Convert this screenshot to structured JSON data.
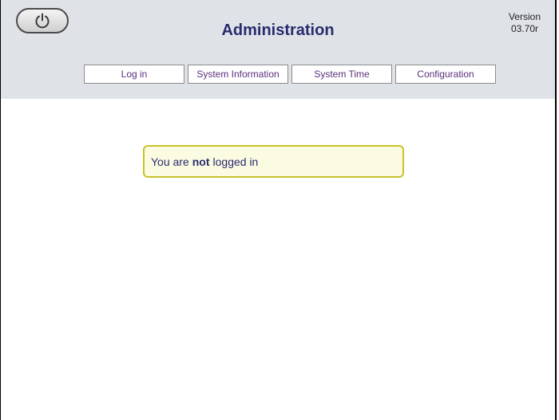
{
  "header": {
    "title": "Administration",
    "version_label": "Version",
    "version_number": "03.70r",
    "power_icon": "power-icon"
  },
  "nav": {
    "items": [
      {
        "label": "Log in"
      },
      {
        "label": "System Information"
      },
      {
        "label": "System Time"
      },
      {
        "label": "Configuration"
      }
    ]
  },
  "notice": {
    "prefix": "You are",
    "emphasis": "not",
    "suffix": "logged in"
  },
  "colors": {
    "header_bg": "#dfe3e8",
    "title": "#2a2a6e",
    "nav_text": "#5c2f7a",
    "notice_border": "#c8c32a",
    "notice_bg": "#fbfbe2"
  }
}
